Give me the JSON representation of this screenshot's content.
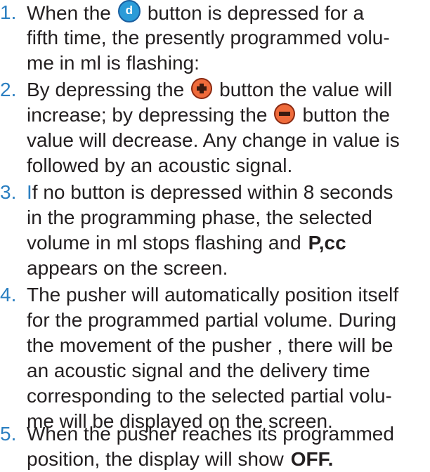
{
  "items": [
    {
      "number": "1.",
      "lines": {
        "l1_pre": "When the",
        "l1_post": "button is depressed for a",
        "l2": "fifth time, the presently programmed volu-",
        "l3": "me in ml is flashing:"
      }
    },
    {
      "number": "2.",
      "lines": {
        "l1_pre": "By depressing the",
        "l1_post": "button the value will",
        "l2_pre": "increase; by depressing the",
        "l2_post": "button the",
        "l3": "value will decrease. Any change in value is",
        "l4": "followed by an acoustic signal."
      }
    },
    {
      "number": "3.",
      "lines": {
        "l1_first": "I",
        "l1_rest": "f no button is depressed within 8 seconds",
        "l2": "in the programming phase, the selected",
        "l3_pre": "volume in ml stops flashing and",
        "l3_bold": "P,cc",
        "l4": "appears on the screen."
      }
    },
    {
      "number": "4.",
      "lines": {
        "l1": "The pusher will automatically position itself",
        "l2": "for the programmed partial volume. During",
        "l3": "the movement of the pusher , there will be",
        "l4": "an acoustic signal and the delivery time",
        "l5": "corresponding to the selected partial volu-",
        "l6": "me will be displayed on the screen."
      }
    },
    {
      "number": "5.",
      "lines": {
        "l1": "When the pusher reaches its programmed",
        "l2_pre": "position, the display will show",
        "l2_bold": "OFF."
      }
    }
  ],
  "buttons": {
    "d_label": "d",
    "d_color": "#2b9bd8",
    "plus_color": "#ef6b3b",
    "minus_color": "#ef6b3b"
  },
  "colors": {
    "number": "#2b7fc1",
    "text": "#231f20"
  }
}
